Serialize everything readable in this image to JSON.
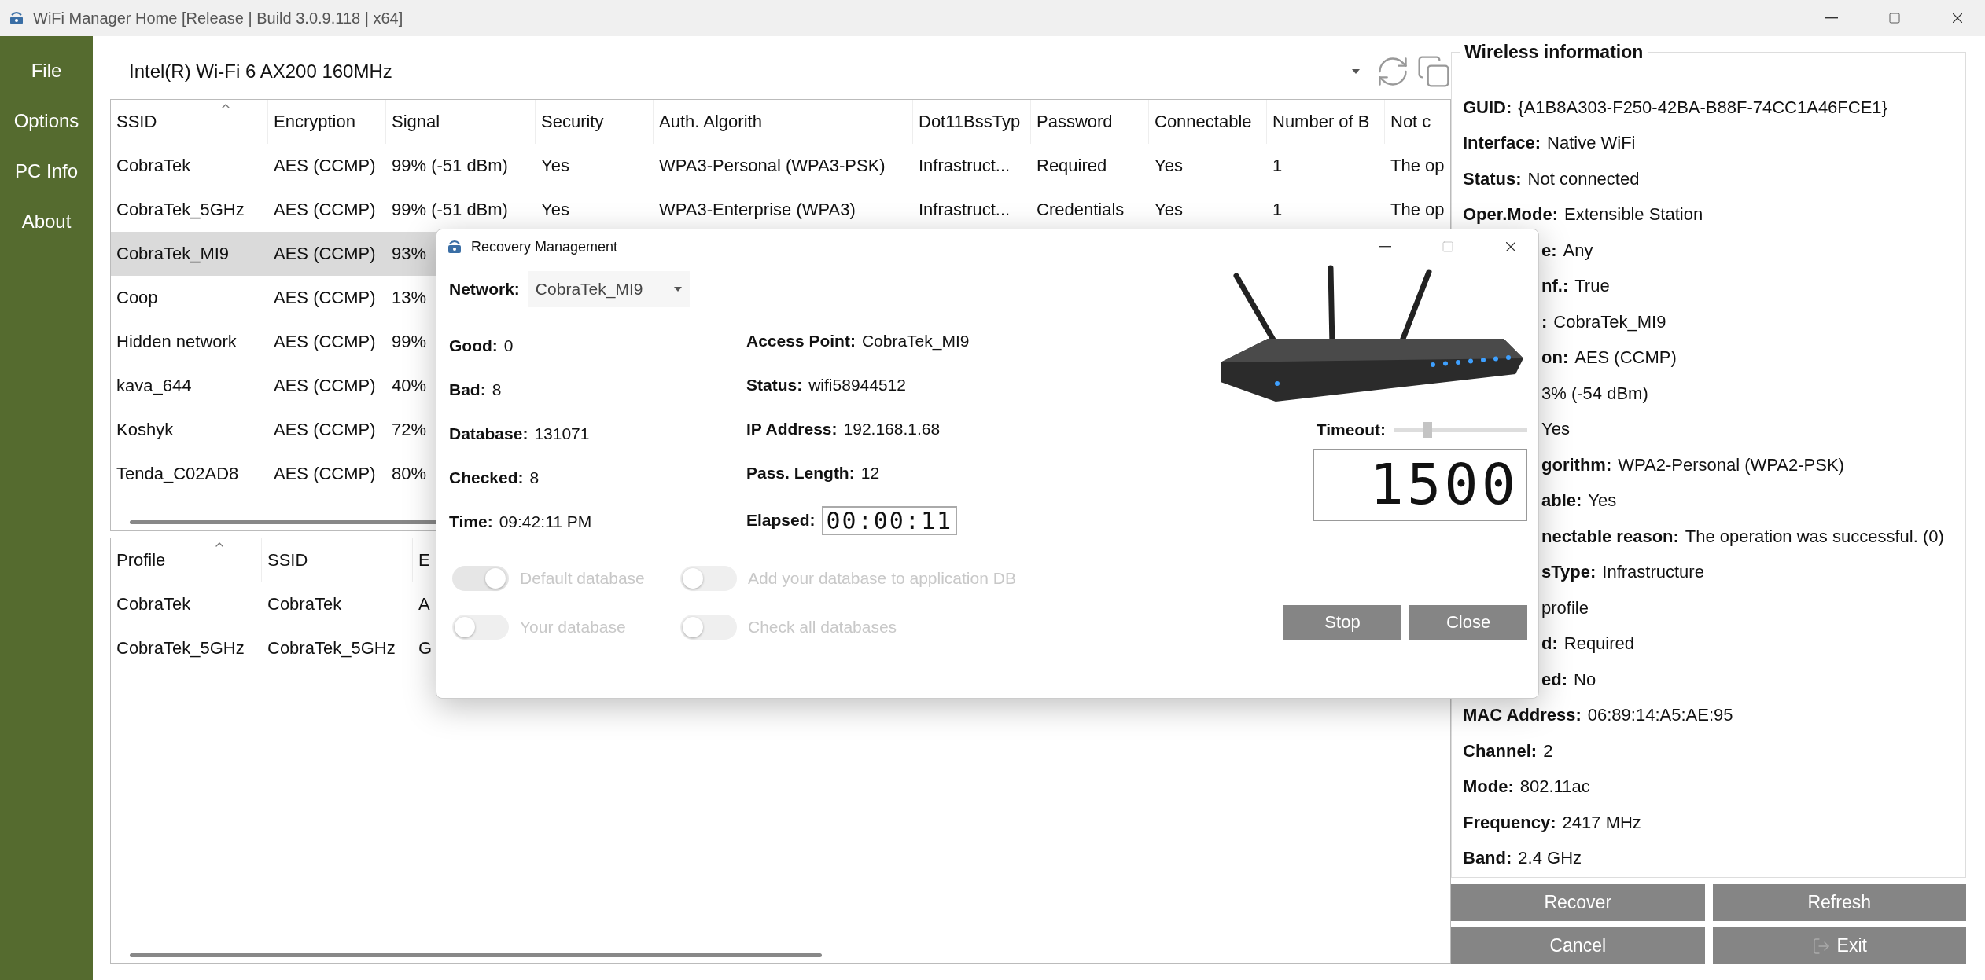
{
  "window": {
    "title": "WiFi Manager Home [Release | Build 3.0.9.118 | x64]"
  },
  "sidebar": {
    "items": [
      {
        "label": "File"
      },
      {
        "label": "Options"
      },
      {
        "label": "PC Info"
      },
      {
        "label": "About"
      }
    ]
  },
  "adapter": {
    "value": "Intel(R) Wi-Fi 6 AX200 160MHz"
  },
  "networks": {
    "columns": [
      {
        "label": "SSID",
        "sorted": true
      },
      {
        "label": "Encryption",
        "sorted": false
      },
      {
        "label": "Signal",
        "sorted": false
      },
      {
        "label": "Security",
        "sorted": false
      },
      {
        "label": "Auth. Algorith",
        "sorted": false
      },
      {
        "label": "Dot11BssTyp",
        "sorted": false
      },
      {
        "label": "Password",
        "sorted": false
      },
      {
        "label": "Connectable",
        "sorted": false
      },
      {
        "label": "Number of B",
        "sorted": false
      },
      {
        "label": "Not c",
        "sorted": false
      }
    ],
    "rows": [
      {
        "selected": false,
        "cells": [
          "CobraTek",
          "AES (CCMP)",
          "99% (-51 dBm)",
          "Yes",
          "WPA3-Personal (WPA3-PSK)",
          "Infrastruct...",
          "Required",
          "Yes",
          "1",
          "The op"
        ]
      },
      {
        "selected": false,
        "cells": [
          "CobraTek_5GHz",
          "AES (CCMP)",
          "99% (-51 dBm)",
          "Yes",
          "WPA3-Enterprise (WPA3)",
          "Infrastruct...",
          "Credentials",
          "Yes",
          "1",
          "The op"
        ]
      },
      {
        "selected": true,
        "cells": [
          "CobraTek_MI9",
          "AES (CCMP)",
          "93%"
        ]
      },
      {
        "selected": false,
        "cells": [
          "Coop",
          "AES (CCMP)",
          "13%"
        ]
      },
      {
        "selected": false,
        "cells": [
          "Hidden network",
          "AES (CCMP)",
          "99%"
        ]
      },
      {
        "selected": false,
        "cells": [
          "kava_644",
          "AES (CCMP)",
          "40%"
        ]
      },
      {
        "selected": false,
        "cells": [
          "Koshyk",
          "AES (CCMP)",
          "72%"
        ]
      },
      {
        "selected": false,
        "cells": [
          "Tenda_C02AD8",
          "AES (CCMP)",
          "80%"
        ]
      }
    ]
  },
  "profiles": {
    "columns": [
      {
        "label": "Profile",
        "sorted": true
      },
      {
        "label": "SSID",
        "sorted": false
      },
      {
        "label": "E",
        "sorted": false
      }
    ],
    "rows": [
      {
        "selected": false,
        "cells": [
          "CobraTek",
          "CobraTek",
          "A"
        ]
      },
      {
        "selected": false,
        "cells": [
          "CobraTek_5GHz",
          "CobraTek_5GHz",
          "G"
        ]
      }
    ]
  },
  "wireless_info": {
    "title": "Wireless information",
    "rows": [
      {
        "label": "GUID:",
        "value": "{A1B8A303-F250-42BA-B88F-74CC1A46FCE1}",
        "covered": false
      },
      {
        "label": "Interface:",
        "value": "Native WiFi",
        "covered": false
      },
      {
        "label": "Status:",
        "value": "Not connected",
        "covered": false
      },
      {
        "label": "Oper.Mode:",
        "value": "Extensible Station",
        "covered": false
      },
      {
        "label": "e:",
        "value": "Any",
        "covered": true
      },
      {
        "label": "nf.:",
        "value": "True",
        "covered": true
      },
      {
        "label": ":",
        "value": "CobraTek_MI9",
        "covered": true
      },
      {
        "label": "on:",
        "value": "AES (CCMP)",
        "covered": true
      },
      {
        "value": "3% (-54 dBm)",
        "covered": true
      },
      {
        "value": "Yes",
        "covered": true
      },
      {
        "label": "gorithm:",
        "value": "WPA2-Personal (WPA2-PSK)",
        "covered": true
      },
      {
        "label": "able:",
        "value": "Yes",
        "covered": true
      },
      {
        "label": "nectable reason:",
        "value": "The operation was successful. (0)",
        "covered": true
      },
      {
        "label": "sType:",
        "value": "Infrastructure",
        "covered": true
      },
      {
        "value": "profile",
        "covered": true
      },
      {
        "label": "d:",
        "value": "Required",
        "covered": true
      },
      {
        "label": "ed:",
        "value": "No",
        "covered": true
      },
      {
        "label": "MAC Address:",
        "value": "06:89:14:A5:AE:95",
        "covered": false
      },
      {
        "label": "Channel:",
        "value": "2",
        "covered": false
      },
      {
        "label": "Mode:",
        "value": "802.11ac",
        "covered": false
      },
      {
        "label": "Frequency:",
        "value": "2417 MHz",
        "covered": false
      },
      {
        "label": "Band:",
        "value": "2.4 GHz",
        "covered": false
      }
    ]
  },
  "buttons": [
    {
      "label": "Recover",
      "kind": "plain"
    },
    {
      "label": "Refresh",
      "kind": "plain"
    },
    {
      "label": "Cancel",
      "kind": "plain"
    },
    {
      "label": "Exit",
      "kind": "exit"
    }
  ],
  "dialog": {
    "title": "Recovery Management",
    "network": {
      "label": "Network:",
      "value": "CobraTek_MI9"
    },
    "stats": [
      {
        "label": "Good:",
        "value": "0"
      },
      {
        "label": "Bad:",
        "value": "8"
      },
      {
        "label": "Database:",
        "value": "131071"
      },
      {
        "label": "Checked:",
        "value": "8"
      },
      {
        "label": "Time:",
        "value": "09:42:11 PM"
      }
    ],
    "details": [
      {
        "label": "Access Point:",
        "value": "CobraTek_MI9"
      },
      {
        "label": "Status:",
        "value": "wifi58944512"
      },
      {
        "label": "IP Address:",
        "value": "192.168.1.68"
      },
      {
        "label": "Pass. Length:",
        "value": "12"
      }
    ],
    "elapsed": {
      "label": "Elapsed:",
      "value": "00:00:11"
    },
    "timeout": {
      "label": "Timeout:",
      "level": 0.25
    },
    "counter": "1500",
    "toggles": [
      {
        "label": "Default database",
        "on": true,
        "disabled": true
      },
      {
        "label": "Add your database to application DB",
        "on": false,
        "disabled": true
      },
      {
        "label": "Your database",
        "on": false,
        "disabled": true
      },
      {
        "label": "Check all databases",
        "on": false,
        "disabled": true
      }
    ],
    "buttons": [
      {
        "label": "Stop"
      },
      {
        "label": "Close"
      }
    ]
  }
}
